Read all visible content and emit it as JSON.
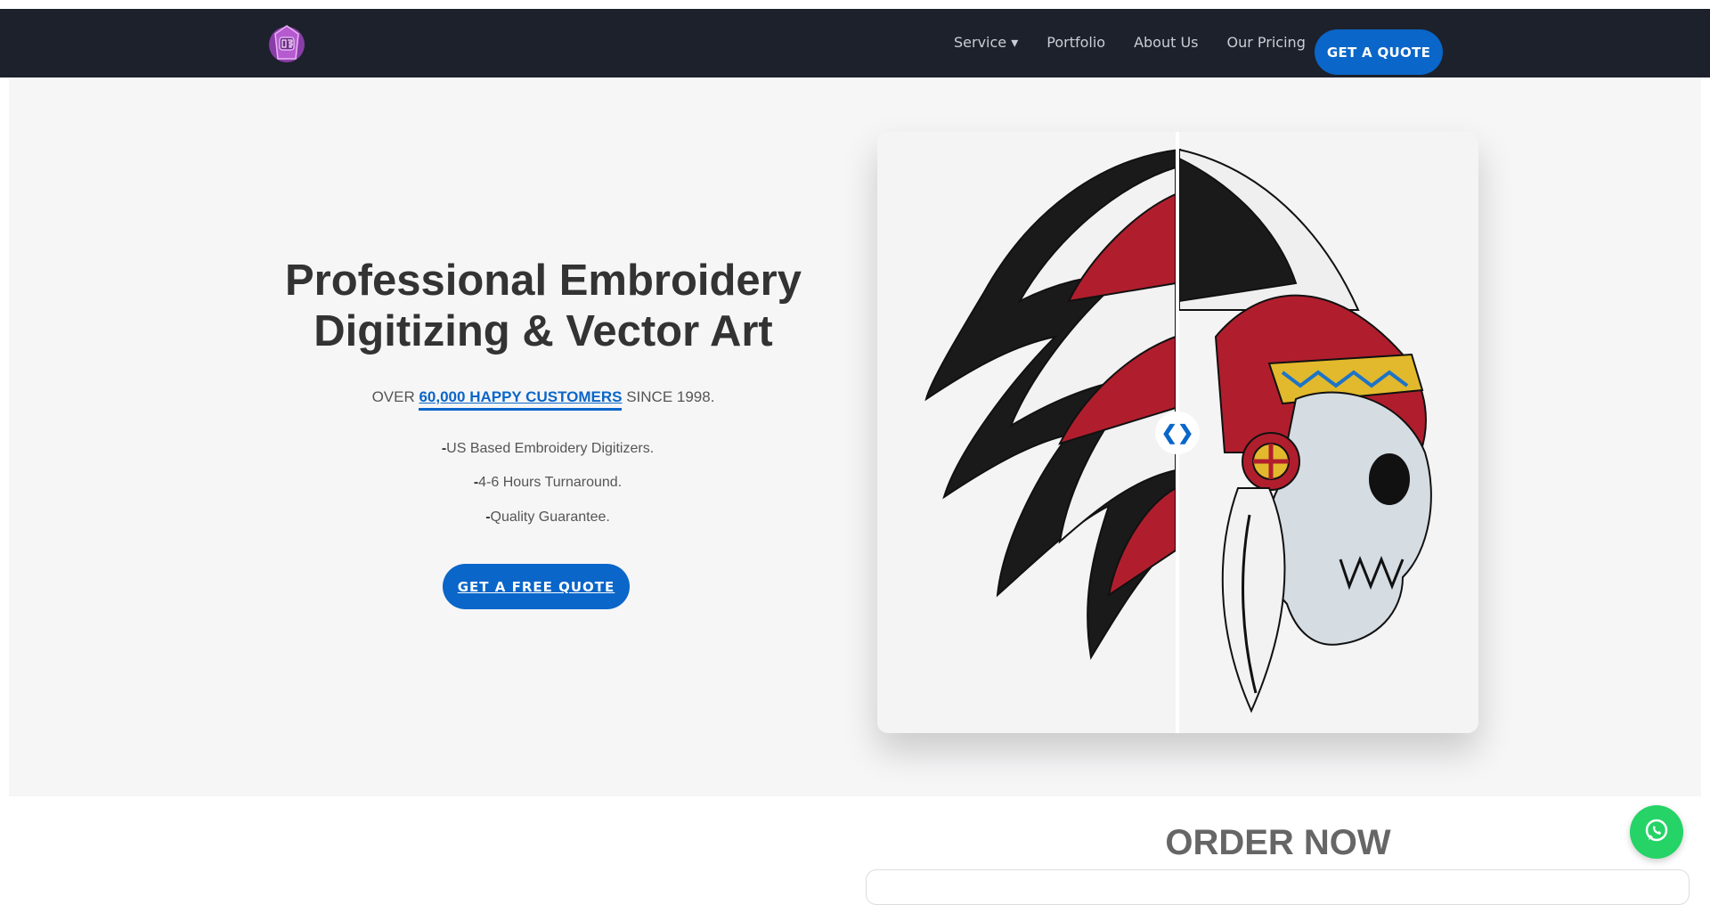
{
  "nav": {
    "logo_alt": "logo",
    "items": [
      "Service ▾",
      "Portfolio",
      "About Us",
      "Our Pricing"
    ],
    "cta": "GET A QUOTE"
  },
  "hero": {
    "title_line1": "Professional Embroidery",
    "title_line2": "Digitizing & Vector Art",
    "sub_prefix": "OVER ",
    "sub_highlight": "60,000 HAPPY CUSTOMERS",
    "sub_suffix": " SINCE 1998.",
    "features": [
      {
        "dash": "-",
        "text": "US Based Embroidery Digitizers."
      },
      {
        "dash": "-",
        "text": "4-6 Hours Turnaround."
      },
      {
        "dash": "-",
        "text": "Quality Guarantee."
      }
    ],
    "cta": "GET A FREE QUOTE"
  },
  "compare": {
    "handle": "❮❯"
  },
  "order": {
    "title": "ORDER NOW"
  },
  "colors": {
    "nav_bg": "#1c212b",
    "accent": "#0a66c8",
    "whatsapp": "#25d366"
  },
  "icons": {
    "whatsapp": "whatsapp-icon"
  }
}
